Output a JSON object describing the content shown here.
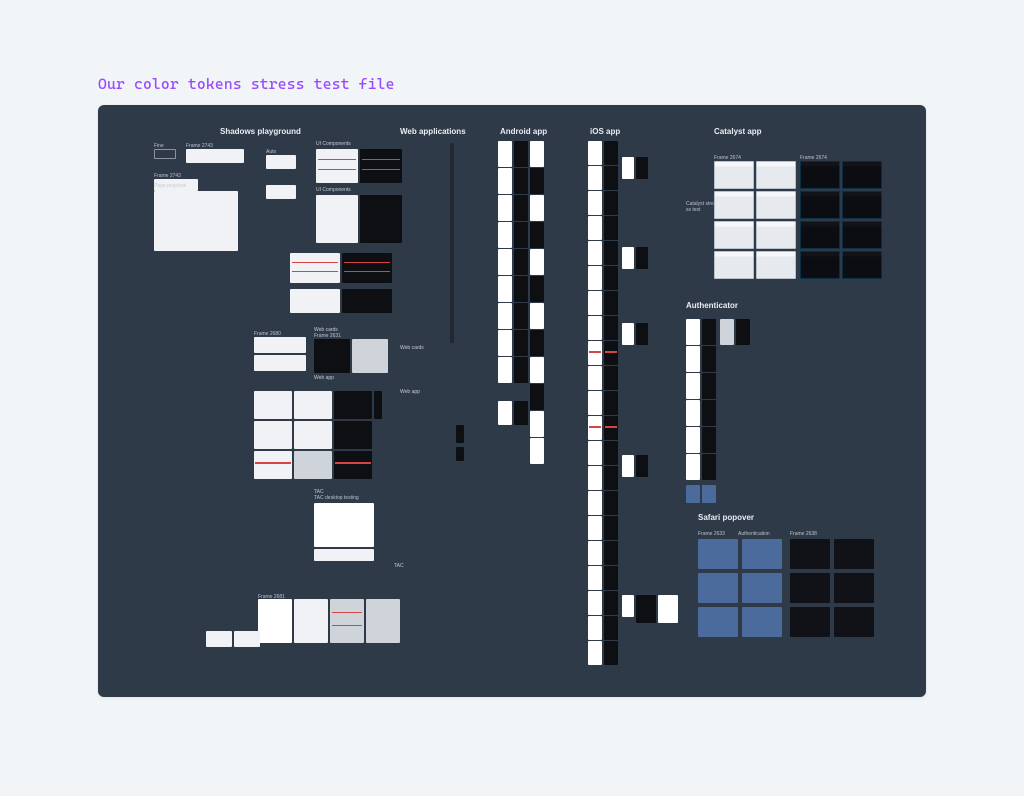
{
  "caption": "Our color tokens stress test file",
  "sections": {
    "shadows": "Shadows playground",
    "web": "Web applications",
    "android": "Android app",
    "ios": "iOS app",
    "catalyst": "Catalyst app",
    "auth": "Authenticator",
    "safari": "Safari popover"
  },
  "labels": {
    "pageProposal": "Page proposal",
    "frame2743": "Frame 2743",
    "frame2680": "Frame 2680",
    "frame2681": "Frame 2681",
    "uiComponents": "UI Components",
    "uiComponents2": "UI Components",
    "webCards": "Web cards",
    "webCards2": "Web cards",
    "webApp": "Web app",
    "webApp2": "Web app",
    "tac": "TAC",
    "tac2": "TAC",
    "tacDesktop": "TAC desktop testing",
    "frame2631": "Frame 2631",
    "catFrame1": "Frame 2674",
    "catFrame2": "Frame 2674",
    "safFrame1": "Frame 2633",
    "safFrame2": "Frame 2638",
    "safLabel": "Authentication"
  }
}
